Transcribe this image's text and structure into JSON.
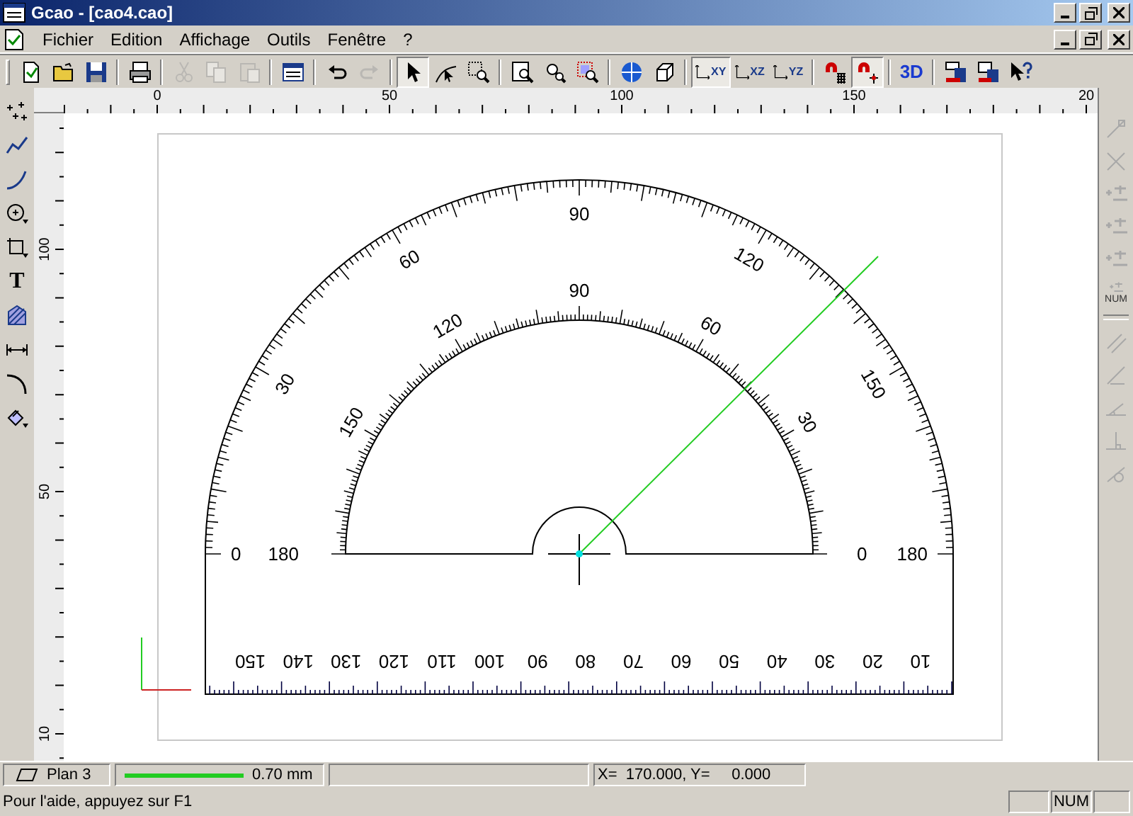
{
  "window": {
    "title": "Gcao - [cao4.cao]"
  },
  "menu": [
    "Fichier",
    "Edition",
    "Affichage",
    "Outils",
    "Fenêtre",
    "?"
  ],
  "toolbar": [
    [
      {
        "kind": "new",
        "pressed": false,
        "disabled": false
      },
      {
        "kind": "open",
        "pressed": false,
        "disabled": false
      },
      {
        "kind": "save",
        "pressed": false,
        "disabled": false
      }
    ],
    [
      {
        "kind": "print",
        "pressed": false,
        "disabled": false
      }
    ],
    [
      {
        "kind": "cut",
        "pressed": false,
        "disabled": true
      },
      {
        "kind": "copy",
        "pressed": false,
        "disabled": true
      },
      {
        "kind": "paste",
        "pressed": false,
        "disabled": true
      }
    ],
    [
      {
        "kind": "window",
        "pressed": false,
        "disabled": false
      }
    ],
    [
      {
        "kind": "undo",
        "pressed": false,
        "disabled": false
      },
      {
        "kind": "redo",
        "pressed": false,
        "disabled": true
      }
    ],
    [
      {
        "kind": "select",
        "pressed": true,
        "disabled": false
      },
      {
        "kind": "curve-select",
        "pressed": false,
        "disabled": false
      },
      {
        "kind": "zoom-window",
        "pressed": false,
        "disabled": false
      }
    ],
    [
      {
        "kind": "zoom-page",
        "pressed": false,
        "disabled": false
      },
      {
        "kind": "zoom-previous",
        "pressed": false,
        "disabled": false
      },
      {
        "kind": "zoom-selection",
        "pressed": false,
        "disabled": false
      }
    ],
    [
      {
        "kind": "globe",
        "pressed": false,
        "disabled": false
      },
      {
        "kind": "cube",
        "pressed": false,
        "disabled": false
      }
    ],
    [
      {
        "kind": "plane",
        "label": "XY",
        "pressed": true,
        "disabled": false
      },
      {
        "kind": "plane",
        "label": "XZ",
        "pressed": false,
        "disabled": false
      },
      {
        "kind": "plane",
        "label": "YZ",
        "pressed": false,
        "disabled": false
      }
    ],
    [
      {
        "kind": "magnet-grid",
        "pressed": false,
        "disabled": false
      },
      {
        "kind": "magnet-point",
        "pressed": true,
        "disabled": false
      }
    ],
    [
      {
        "kind": "label",
        "label": "3D",
        "pressed": false,
        "disabled": false
      }
    ],
    [
      {
        "kind": "front",
        "pressed": false,
        "disabled": false
      },
      {
        "kind": "front3d",
        "pressed": false,
        "disabled": false
      },
      {
        "kind": "help",
        "pressed": false,
        "disabled": false
      }
    ]
  ],
  "left_toolbar": [
    {
      "kind": "points"
    },
    {
      "kind": "polyline"
    },
    {
      "kind": "curve"
    },
    {
      "kind": "circle"
    },
    {
      "kind": "rectangle"
    },
    {
      "kind": "text",
      "label": "T"
    },
    {
      "kind": "hatch"
    },
    {
      "kind": "dimension"
    },
    {
      "kind": "fillet"
    },
    {
      "kind": "transform"
    }
  ],
  "right_toolbar": [
    [
      {
        "kind": "endpoint",
        "disabled": true
      },
      {
        "kind": "intersection",
        "disabled": true
      },
      {
        "kind": "axis",
        "disabled": true
      },
      {
        "kind": "axis",
        "disabled": true
      },
      {
        "kind": "axis",
        "disabled": true
      },
      {
        "kind": "axis",
        "label": "NUM",
        "disabled": true
      }
    ],
    [
      {
        "kind": "parallel",
        "disabled": true
      },
      {
        "kind": "slope",
        "disabled": true
      },
      {
        "kind": "angle",
        "disabled": true
      },
      {
        "kind": "perpendicular",
        "disabled": true
      },
      {
        "kind": "tangent",
        "disabled": true
      }
    ]
  ],
  "horizontal_ruler": [
    "0",
    "50",
    "100",
    "150",
    "20"
  ],
  "vertical_ruler": [
    "100",
    "50",
    "10"
  ],
  "protractor": {
    "outer_scale": [
      "0",
      "30",
      "60",
      "90",
      "120",
      "150",
      "180"
    ],
    "inner_scale": [
      "180",
      "150",
      "120",
      "90",
      "60",
      "30",
      "0"
    ],
    "ruler_scale": [
      "10",
      "20",
      "30",
      "40",
      "50",
      "60",
      "70",
      "80",
      "90",
      "100",
      "110",
      "120",
      "130",
      "140",
      "150"
    ]
  },
  "status_bar": {
    "layer": "Plan 3",
    "pen": {
      "color": "#22cc22",
      "width": "0.70 mm"
    },
    "coordinates": "X=  170.000, Y=     0.000",
    "help": "Pour l'aide, appuyez sur F1",
    "indicator": "NUM"
  }
}
